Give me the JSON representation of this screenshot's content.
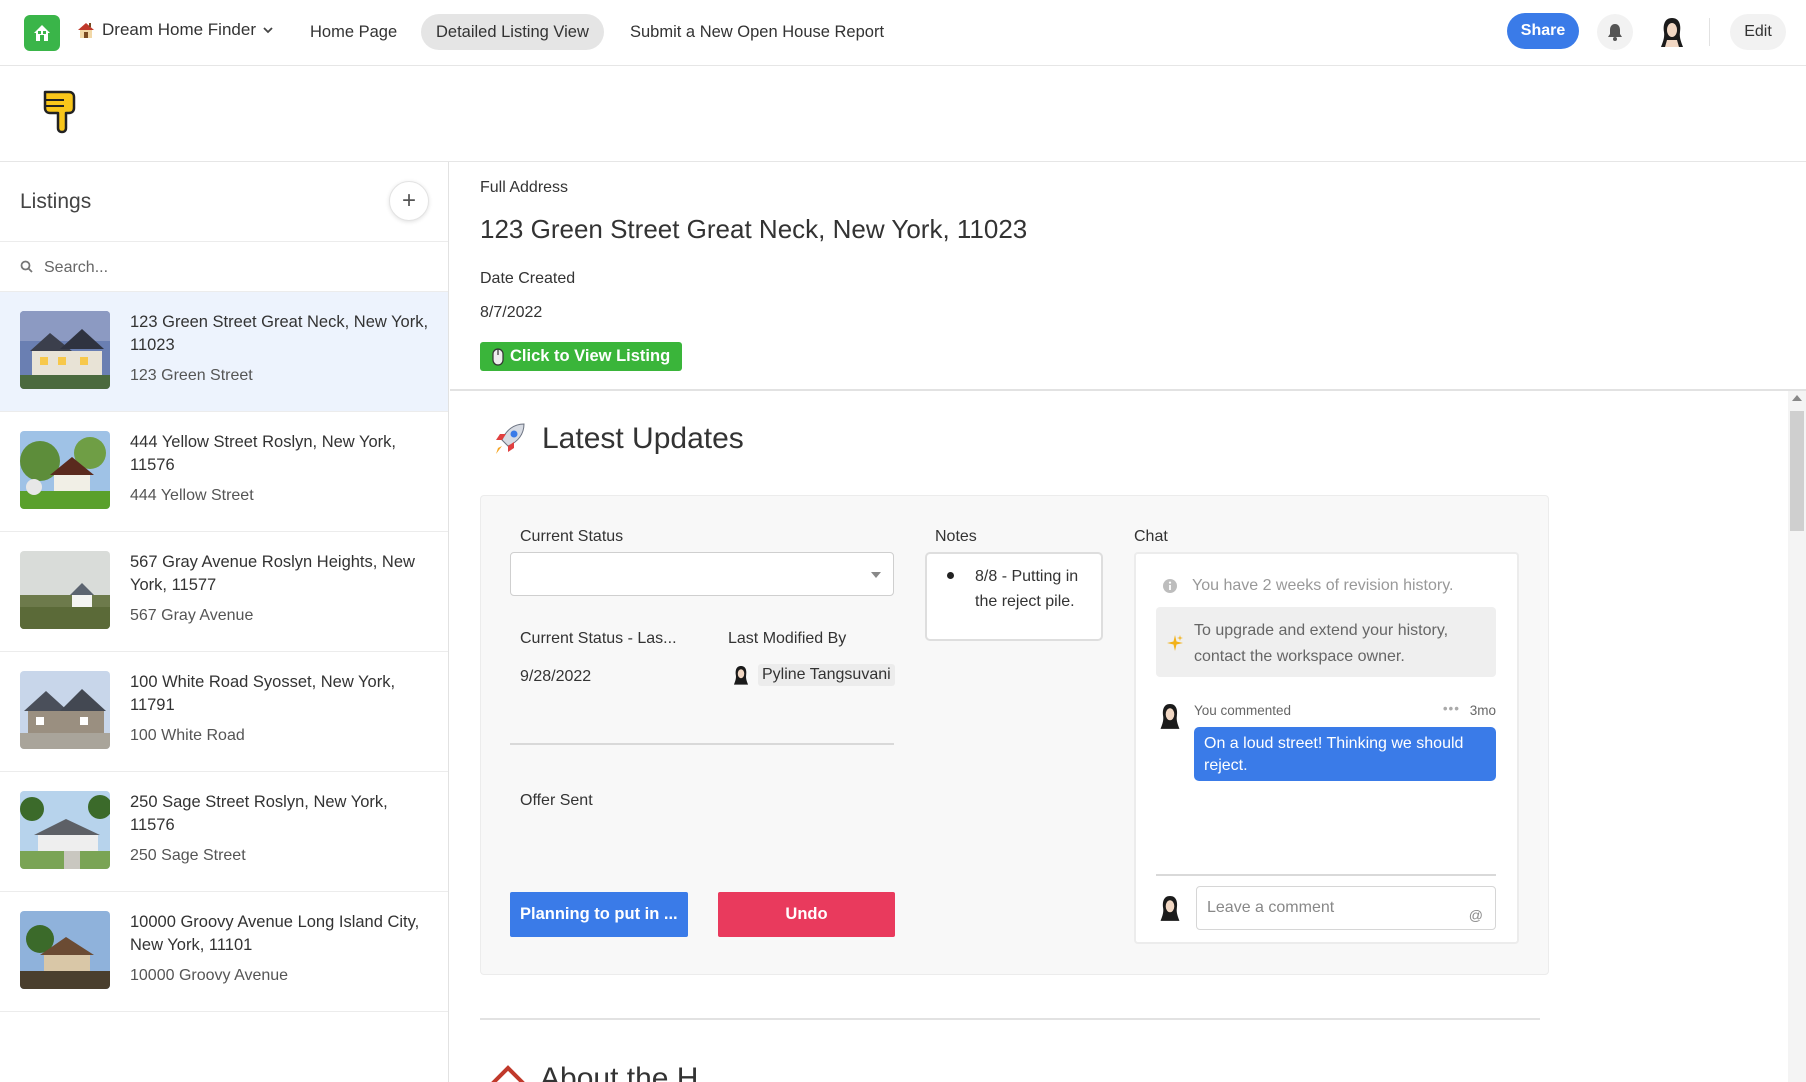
{
  "topbar": {
    "app_name": "Dream Home Finder",
    "nav": [
      "Home Page",
      "Detailed Listing View",
      "Submit a New Open House Report"
    ],
    "active_nav": "Detailed Listing View",
    "share_label": "Share",
    "edit_label": "Edit"
  },
  "sidebar": {
    "title": "Listings",
    "add_label": "+",
    "search_placeholder": "Search...",
    "listings": [
      {
        "title": "123 Green Street Great Neck, New York, 11023",
        "subtitle": "123 Green Street",
        "selected": true
      },
      {
        "title": "444 Yellow Street Roslyn, New York, 11576",
        "subtitle": "444 Yellow Street",
        "selected": false
      },
      {
        "title": "567 Gray Avenue Roslyn Heights, New York, 11577",
        "subtitle": "567 Gray Avenue",
        "selected": false
      },
      {
        "title": "100 White Road Syosset, New York, 11791",
        "subtitle": "100 White Road",
        "selected": false
      },
      {
        "title": "250 Sage Street Roslyn, New York, 11576",
        "subtitle": "250 Sage Street",
        "selected": false
      },
      {
        "title": "10000 Groovy Avenue Long Island City, New York, 11101",
        "subtitle": "10000 Groovy Avenue",
        "selected": false
      }
    ]
  },
  "detail": {
    "full_address_label": "Full Address",
    "full_address": "123 Green Street Great Neck, New York, 11023",
    "date_created_label": "Date Created",
    "date_created": "8/7/2022",
    "view_listing_label": "Click to View Listing"
  },
  "updates": {
    "title": "Latest Updates",
    "current_status_label": "Current Status",
    "current_status_value": "",
    "current_status_last_label": "Current Status - Las...",
    "current_status_last_value": "9/28/2022",
    "last_modified_by_label": "Last Modified By",
    "last_modified_by": "Pyline Tangsuvani",
    "offer_sent_label": "Offer Sent",
    "plan_button": "Planning to put in ...",
    "undo_button": "Undo",
    "notes_label": "Notes",
    "notes_item": "8/8 - Putting in the reject pile.",
    "chat_label": "Chat",
    "revision_info": "You have 2 weeks of revision history.",
    "upgrade_text": "To upgrade and extend your history, contact the workspace owner.",
    "comment_author": "You commented",
    "comment_time": "3mo",
    "comment_text": "On a loud street! Thinking we should reject.",
    "comment_placeholder": "Leave a comment",
    "comment_at": "@"
  },
  "about": {
    "title_partial": "About the H"
  },
  "colors": {
    "accent_blue": "#3a7be8",
    "green": "#3ab549",
    "undo_red": "#e93a5d",
    "selected_row": "#edf3fd"
  }
}
